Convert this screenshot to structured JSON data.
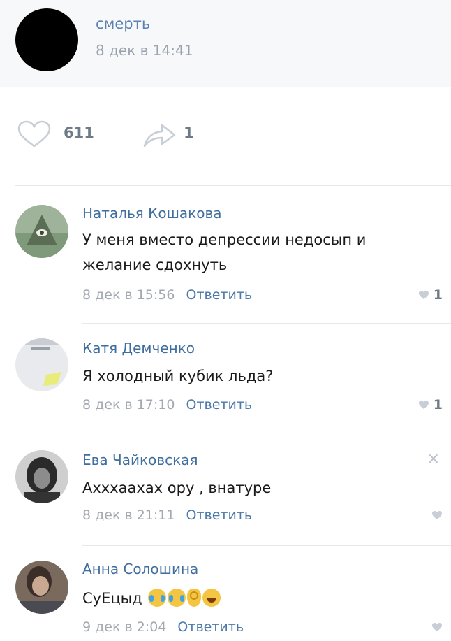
{
  "post": {
    "author": "смерть",
    "time": "8 дек в 14:41"
  },
  "actions": {
    "likes": "611",
    "shares": "1"
  },
  "comments": [
    {
      "name": "Наталья Кошакова",
      "text": "У меня вместо депрессии недосып и желание сдохнуть",
      "time": "8 дек в 15:56",
      "reply": "Ответить",
      "likes": "1"
    },
    {
      "name": "Катя Демченко",
      "text": "Я холодный кубик льда?",
      "time": "8 дек в 17:10",
      "reply": "Ответить",
      "likes": "1"
    },
    {
      "name": "Ева Чайковская",
      "text": "Ахххаахах ору , внатуре",
      "time": "8 дек в 21:11",
      "reply": "Ответить",
      "likes": "",
      "close": "×"
    },
    {
      "name": "Анна Солошина",
      "text": "СуЕцыд",
      "time": "9 дек в 2:04",
      "reply": "Ответить",
      "likes": "",
      "emojis": [
        "crying-laughing",
        "crying-laughing",
        "ok-hand",
        "grinning"
      ]
    }
  ],
  "colors": {
    "link": "#3f6e9e",
    "meta": "#a2a9b0",
    "icon": "#c8ced6"
  }
}
